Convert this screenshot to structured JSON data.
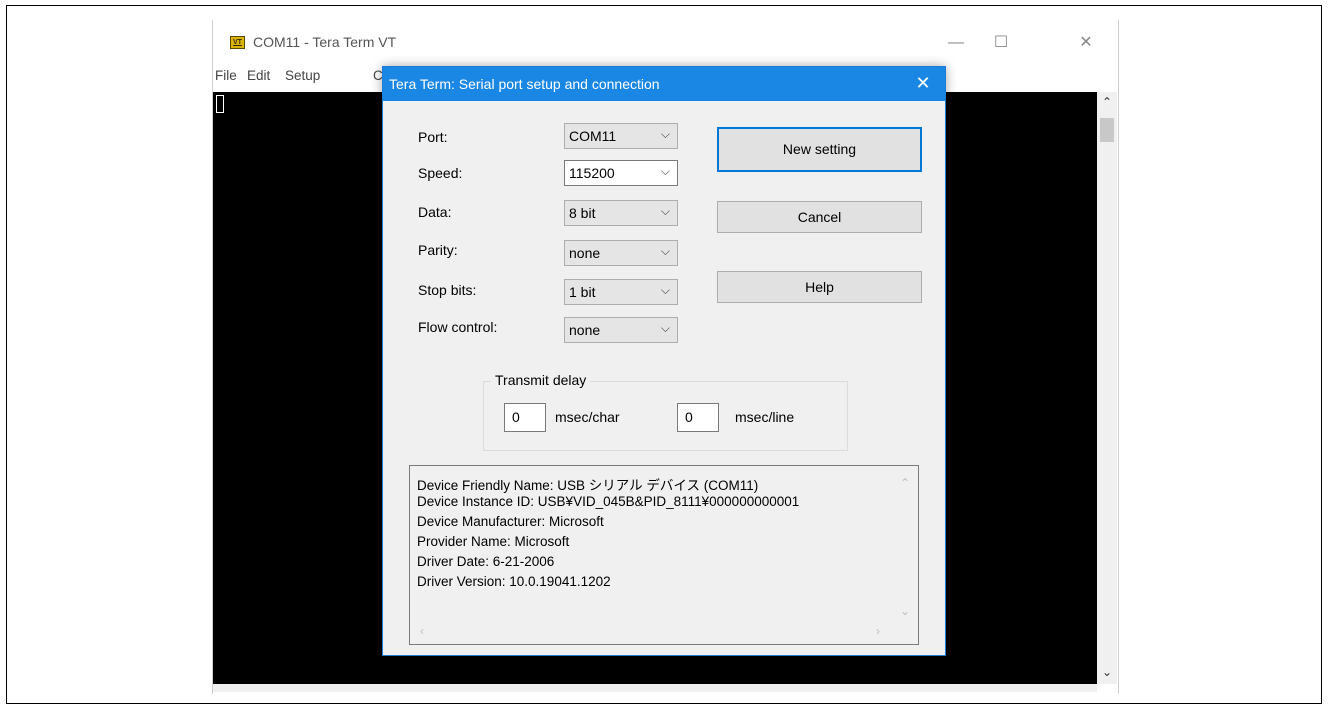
{
  "window": {
    "title": "COM11 - Tera Term VT",
    "icon": "VT",
    "controls": {
      "minimize": "—",
      "maximize": "☐",
      "close": "✕"
    }
  },
  "menu": [
    "File",
    "Edit",
    "Setup",
    "C"
  ],
  "terminal": {
    "background": "#000000"
  },
  "scrollbar": {
    "up": "⌃",
    "down": "⌄"
  },
  "dialog": {
    "title": "Tera Term: Serial port setup and connection",
    "close": "✕",
    "fields": [
      {
        "label": "Port:",
        "value": "COM11"
      },
      {
        "label": "Speed:",
        "value": "115200"
      },
      {
        "label": "Data:",
        "value": "8 bit"
      },
      {
        "label": "Parity:",
        "value": "none"
      },
      {
        "label": "Stop bits:",
        "value": "1 bit"
      },
      {
        "label": "Flow control:",
        "value": "none"
      }
    ],
    "buttons": {
      "new_setting": "New setting",
      "cancel": "Cancel",
      "help": "Help"
    },
    "transmit_delay": {
      "legend": "Transmit delay",
      "char_value": "0",
      "char_unit": "msec/char",
      "line_value": "0",
      "line_unit": "msec/line"
    },
    "device_info": [
      "Device Friendly Name: USB シリアル デバイス (COM11)",
      "Device Instance ID: USB¥VID_045B&PID_8111¥000000000001",
      "Device Manufacturer: Microsoft",
      "Provider Name: Microsoft",
      "Driver Date: 6-21-2006",
      "Driver Version: 10.0.19041.1202"
    ],
    "chevron": "⌵",
    "colors": {
      "titlebar": "#1b87e5",
      "accent": "#0078d7"
    }
  }
}
